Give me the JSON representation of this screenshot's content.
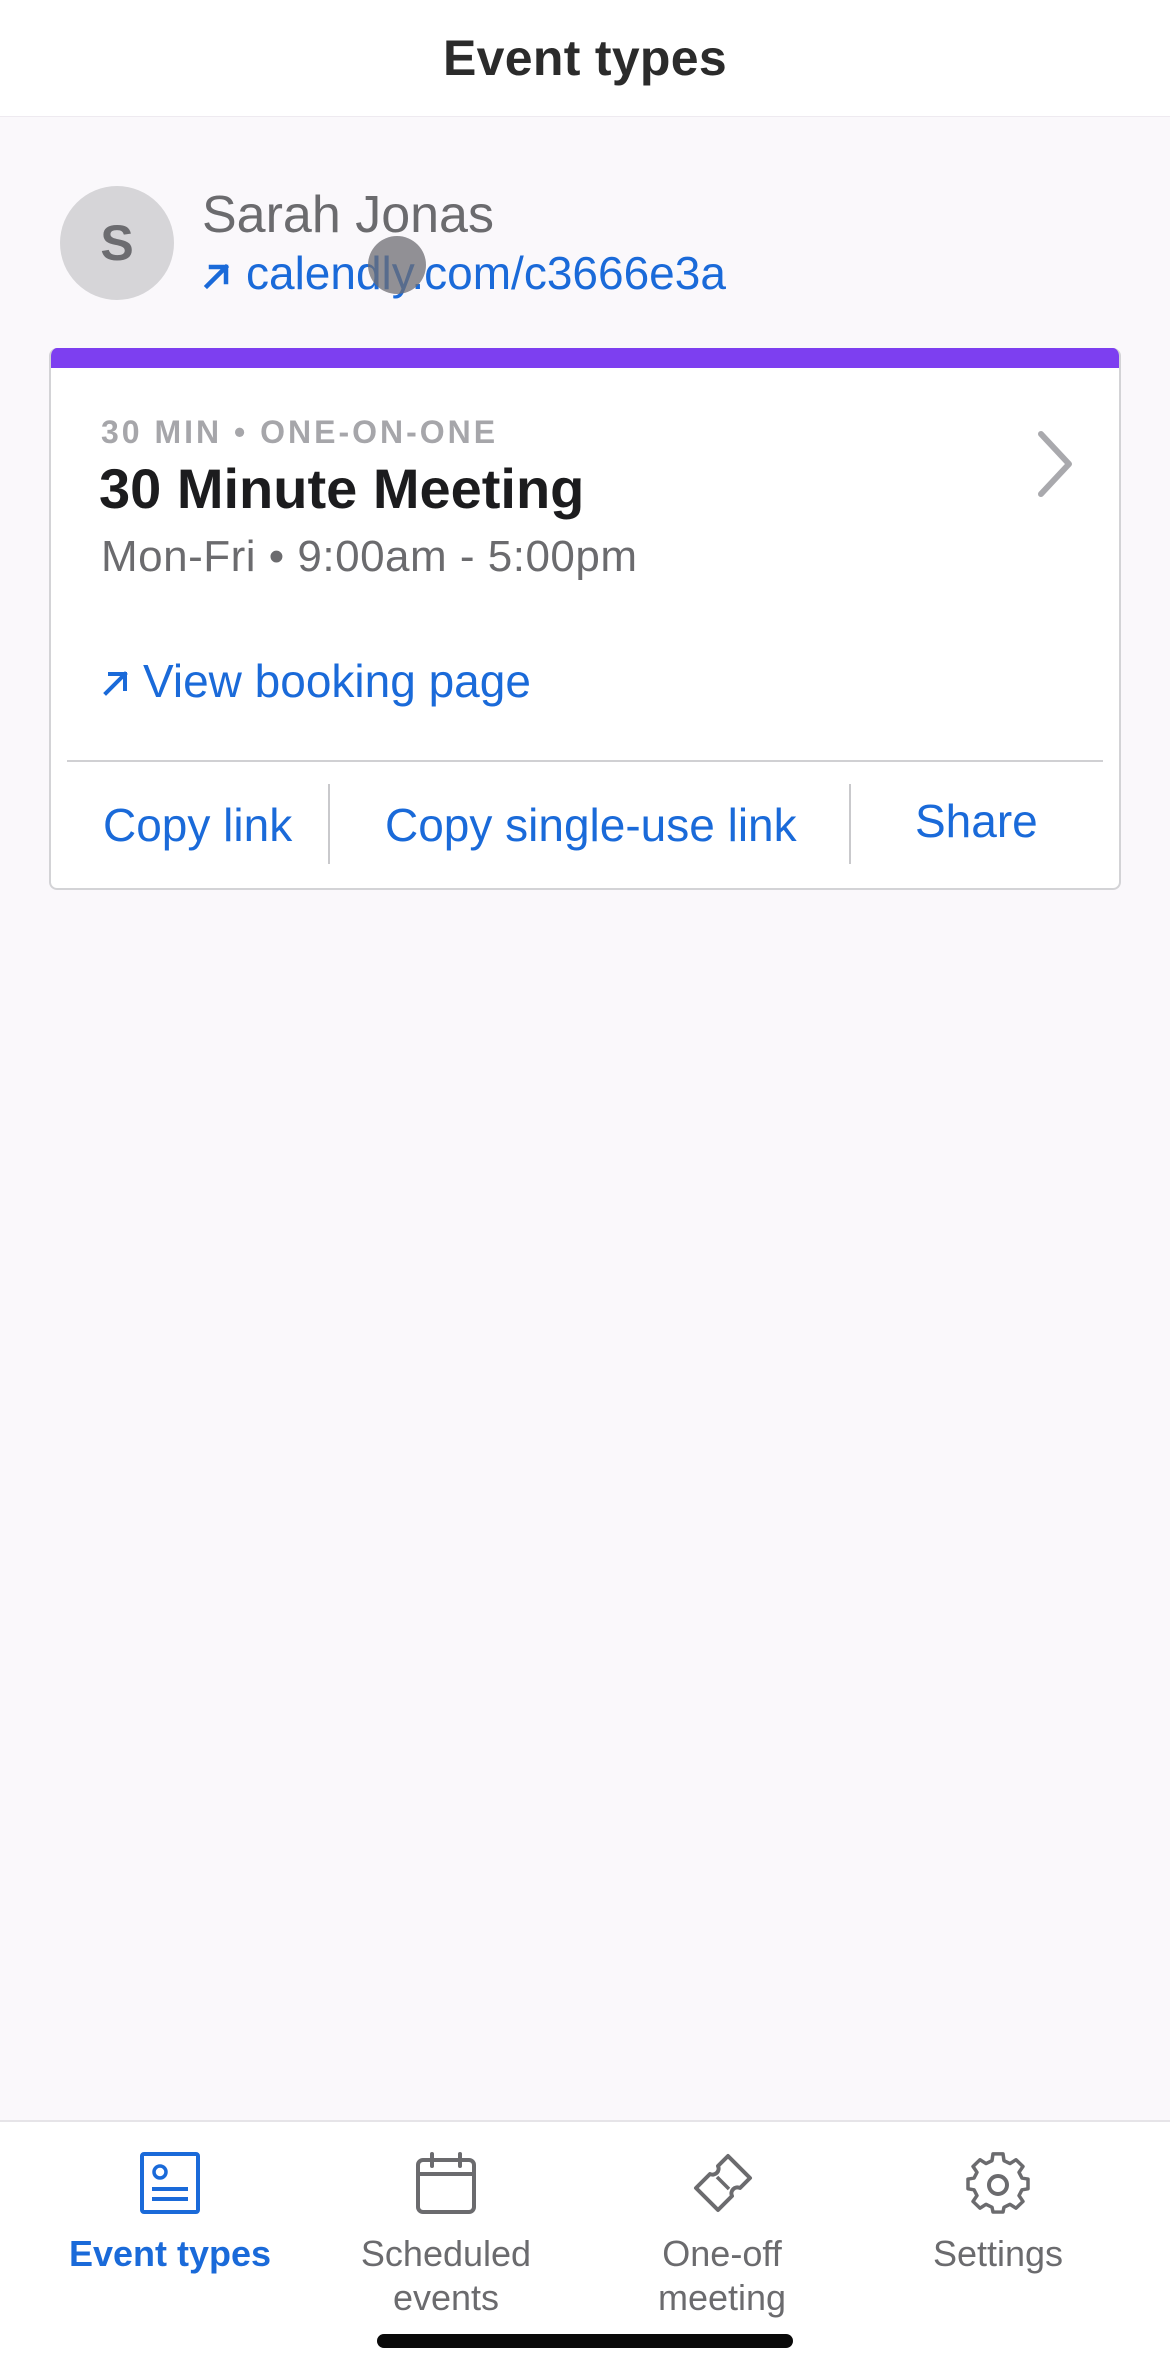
{
  "header": {
    "title": "Event types"
  },
  "profile": {
    "initial": "S",
    "name": "Sarah Jonas",
    "link": "calendly.com/c3666e3a"
  },
  "event_card": {
    "accent_color": "#7d3ff0",
    "meta": "30 MIN • ONE-ON-ONE",
    "title": "30 Minute Meeting",
    "schedule": "Mon-Fri • 9:00am - 5:00pm",
    "view_booking_label": "View booking page",
    "actions": {
      "copy_link": "Copy link",
      "copy_single_use_link": "Copy single-use link",
      "share": "Share"
    }
  },
  "tabbar": {
    "active_color": "#1a6ad9",
    "tabs": [
      {
        "label": "Event types",
        "icon": "event-types-icon",
        "active": true
      },
      {
        "label": "Scheduled\nevents",
        "icon": "calendar-icon",
        "active": false
      },
      {
        "label": "One-off\nmeeting",
        "icon": "ticket-icon",
        "active": false
      },
      {
        "label": "Settings",
        "icon": "gear-icon",
        "active": false
      }
    ]
  }
}
